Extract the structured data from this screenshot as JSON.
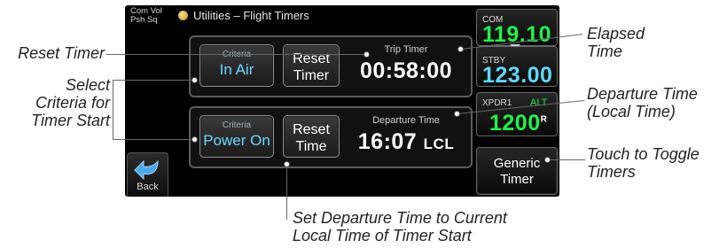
{
  "screen": {
    "top_left_lines": [
      "Com Vol",
      "Psh Sq"
    ],
    "title": "Utilities – Flight Timers",
    "back_label": "Back",
    "trip": {
      "criteria_caption": "Criteria",
      "criteria_value": "In Air",
      "reset_lines": [
        "Reset",
        "Timer"
      ],
      "label": "Trip Timer",
      "value": "00:58:00"
    },
    "departure": {
      "criteria_caption": "Criteria",
      "criteria_value": "Power On",
      "reset_lines": [
        "Reset",
        "Time"
      ],
      "label": "Departure Time",
      "value": "16:07",
      "suffix": "LCL"
    },
    "radio": {
      "com_label": "COM",
      "com_freq": "119.10",
      "stby_label": "STBY",
      "stby_freq": "123.00",
      "xpdr_label": "XPDR1",
      "xpdr_mode": "ALT",
      "xpdr_code": "1200",
      "xpdr_flag": "R"
    },
    "generic_lines": [
      "Generic",
      "Timer"
    ]
  },
  "annotations": {
    "reset_timer": "Reset Timer",
    "select_criteria": [
      "Select",
      "Criteria for",
      "Timer Start"
    ],
    "elapsed_time": [
      "Elapsed",
      "Time"
    ],
    "departure_time": [
      "Departure Time",
      "(Local Time)"
    ],
    "touch_toggle": [
      "Touch to Toggle",
      "Timers"
    ],
    "set_departure": [
      "Set Departure Time to Current",
      "Local Time of Timer Start"
    ]
  },
  "colors": {
    "com_freq": "#24f04a",
    "stby_freq": "#5fd8ff",
    "criteria_value": "#6bd6ff"
  }
}
